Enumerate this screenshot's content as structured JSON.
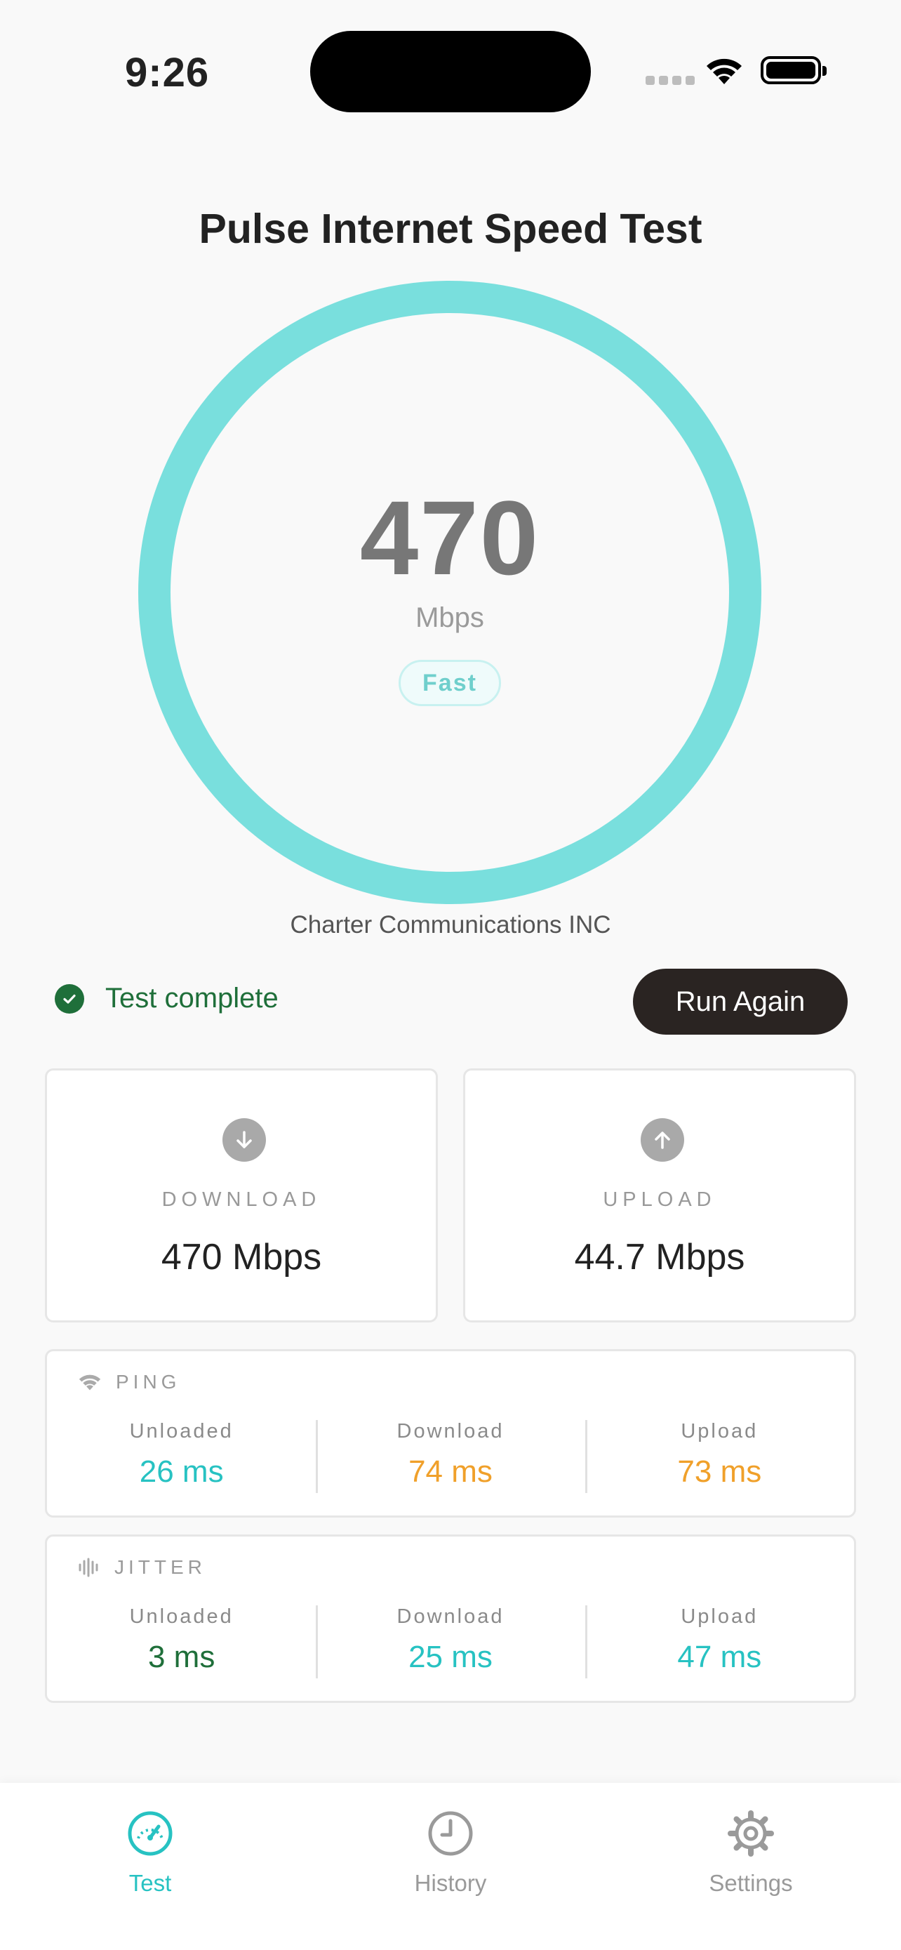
{
  "status_bar": {
    "time": "9:26"
  },
  "app": {
    "title": "Pulse Internet Speed Test"
  },
  "gauge": {
    "value": "470",
    "unit": "Mbps",
    "rating": "Fast"
  },
  "isp": "Charter Communications INC",
  "test_status": {
    "text": "Test complete",
    "button_label": "Run Again"
  },
  "download": {
    "label": "DOWNLOAD",
    "value": "470 Mbps"
  },
  "upload": {
    "label": "UPLOAD",
    "value": "44.7 Mbps"
  },
  "ping": {
    "title": "PING",
    "columns": [
      {
        "label": "Unloaded",
        "value": "26 ms",
        "color": "#27c2c2"
      },
      {
        "label": "Download",
        "value": "74 ms",
        "color": "#f0a02a"
      },
      {
        "label": "Upload",
        "value": "73 ms",
        "color": "#f0a02a"
      }
    ]
  },
  "jitter": {
    "title": "JITTER",
    "columns": [
      {
        "label": "Unloaded",
        "value": "3 ms",
        "color": "#1f6f3a"
      },
      {
        "label": "Download",
        "value": "25 ms",
        "color": "#27c2c2"
      },
      {
        "label": "Upload",
        "value": "47 ms",
        "color": "#27c2c2"
      }
    ]
  },
  "tabs": [
    {
      "label": "Test",
      "icon": "speedometer-icon",
      "active": true
    },
    {
      "label": "History",
      "icon": "clock-icon",
      "active": false
    },
    {
      "label": "Settings",
      "icon": "gear-icon",
      "active": false
    }
  ],
  "colors": {
    "accent": "#27c2c2",
    "ring": "#79dfdd",
    "success": "#1f6f3a",
    "warning": "#f0a02a",
    "inactive": "#9a9a9a"
  }
}
